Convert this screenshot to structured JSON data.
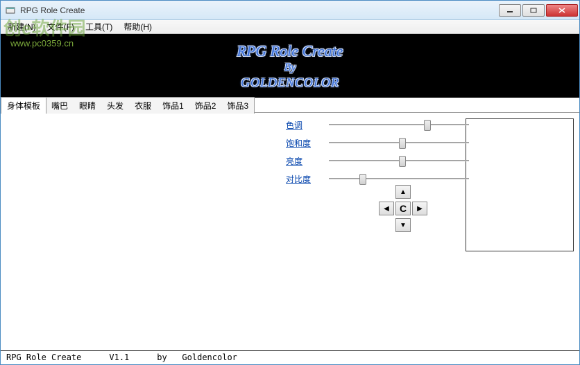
{
  "window": {
    "title": "RPG Role Create"
  },
  "menu": {
    "new": "新建(N)",
    "file": "文件(F)",
    "tools": "工具(T)",
    "help": "帮助(H)"
  },
  "watermark": {
    "text": "创e软件园",
    "url": "www.pc0359.cn"
  },
  "banner": {
    "title": "RPG Role Create",
    "by": "By",
    "author": "GOLDENCOLOR"
  },
  "tabs": [
    "身体模板",
    "嘴巴",
    "眼睛",
    "头发",
    "衣服",
    "饰品1",
    "饰品2",
    "饰品3"
  ],
  "adjustments": {
    "hue": {
      "label": "色调",
      "value": 68
    },
    "saturation": {
      "label": "饱和度",
      "value": 50
    },
    "brightness": {
      "label": "亮度",
      "value": 50
    },
    "contrast": {
      "label": "对比度",
      "value": 22
    }
  },
  "dpad": {
    "center": "C"
  },
  "status": {
    "app": "RPG Role Create",
    "version": "V1.1",
    "by_label": "by",
    "author": "Goldencolor"
  }
}
